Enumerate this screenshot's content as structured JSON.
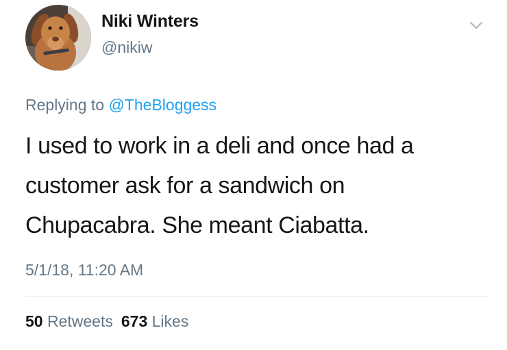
{
  "author": {
    "display_name": "Niki Winters",
    "handle": "@nikiw",
    "avatar": "avatar-dog-photo"
  },
  "reply": {
    "prefix": "Replying to",
    "to_handle": "@TheBloggess"
  },
  "tweet": {
    "lines": [
      "I used to work in a deli and once had a",
      "customer ask for a sandwich on",
      "Chupacabra. She meant Ciabatta."
    ],
    "timestamp": "5/1/18, 11:20 AM"
  },
  "stats": {
    "retweets_count": "50",
    "retweets_label": "Retweets",
    "likes_count": "673",
    "likes_label": "Likes"
  },
  "icons": {
    "menu": "chevron-down-icon"
  },
  "colors": {
    "link": "#1da1f2",
    "secondary_text": "#657786",
    "primary_text": "#14171a"
  }
}
